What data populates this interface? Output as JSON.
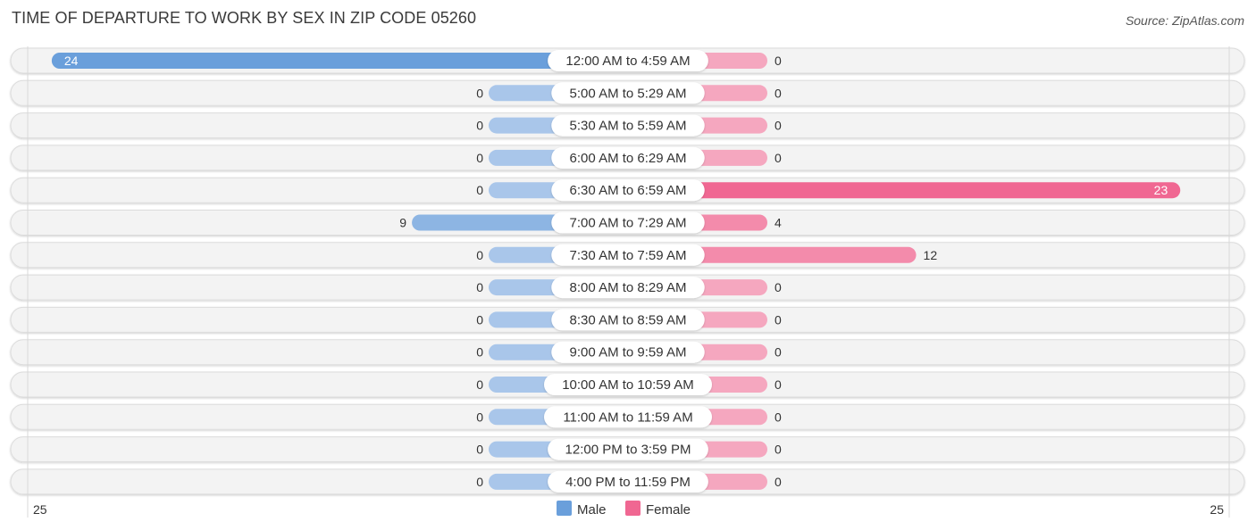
{
  "title": "TIME OF DEPARTURE TO WORK BY SEX IN ZIP CODE 05260",
  "source": "Source: ZipAtlas.com",
  "colors": {
    "male": "#6a9fdb",
    "male_light": "#a9c6ea",
    "female": "#f06792",
    "female_light": "#f5a7bf",
    "row_bg": "#f3f3f3"
  },
  "chart_data": {
    "type": "bar",
    "orientation": "horizontal-diverging",
    "title": "TIME OF DEPARTURE TO WORK BY SEX IN ZIP CODE 05260",
    "categories": [
      "12:00 AM to 4:59 AM",
      "5:00 AM to 5:29 AM",
      "5:30 AM to 5:59 AM",
      "6:00 AM to 6:29 AM",
      "6:30 AM to 6:59 AM",
      "7:00 AM to 7:29 AM",
      "7:30 AM to 7:59 AM",
      "8:00 AM to 8:29 AM",
      "8:30 AM to 8:59 AM",
      "9:00 AM to 9:59 AM",
      "10:00 AM to 10:59 AM",
      "11:00 AM to 11:59 AM",
      "12:00 PM to 3:59 PM",
      "4:00 PM to 11:59 PM"
    ],
    "series": [
      {
        "name": "Male",
        "values": [
          24,
          0,
          0,
          0,
          0,
          9,
          0,
          0,
          0,
          0,
          0,
          0,
          0,
          0
        ]
      },
      {
        "name": "Female",
        "values": [
          0,
          0,
          0,
          0,
          23,
          4,
          12,
          0,
          0,
          0,
          0,
          0,
          0,
          0
        ]
      }
    ],
    "xlim": [
      -25,
      25
    ],
    "axis_tick_labels": {
      "left": "25",
      "right": "25"
    },
    "legend": {
      "position": "bottom-center",
      "entries": [
        "Male",
        "Female"
      ]
    },
    "grid": false
  }
}
